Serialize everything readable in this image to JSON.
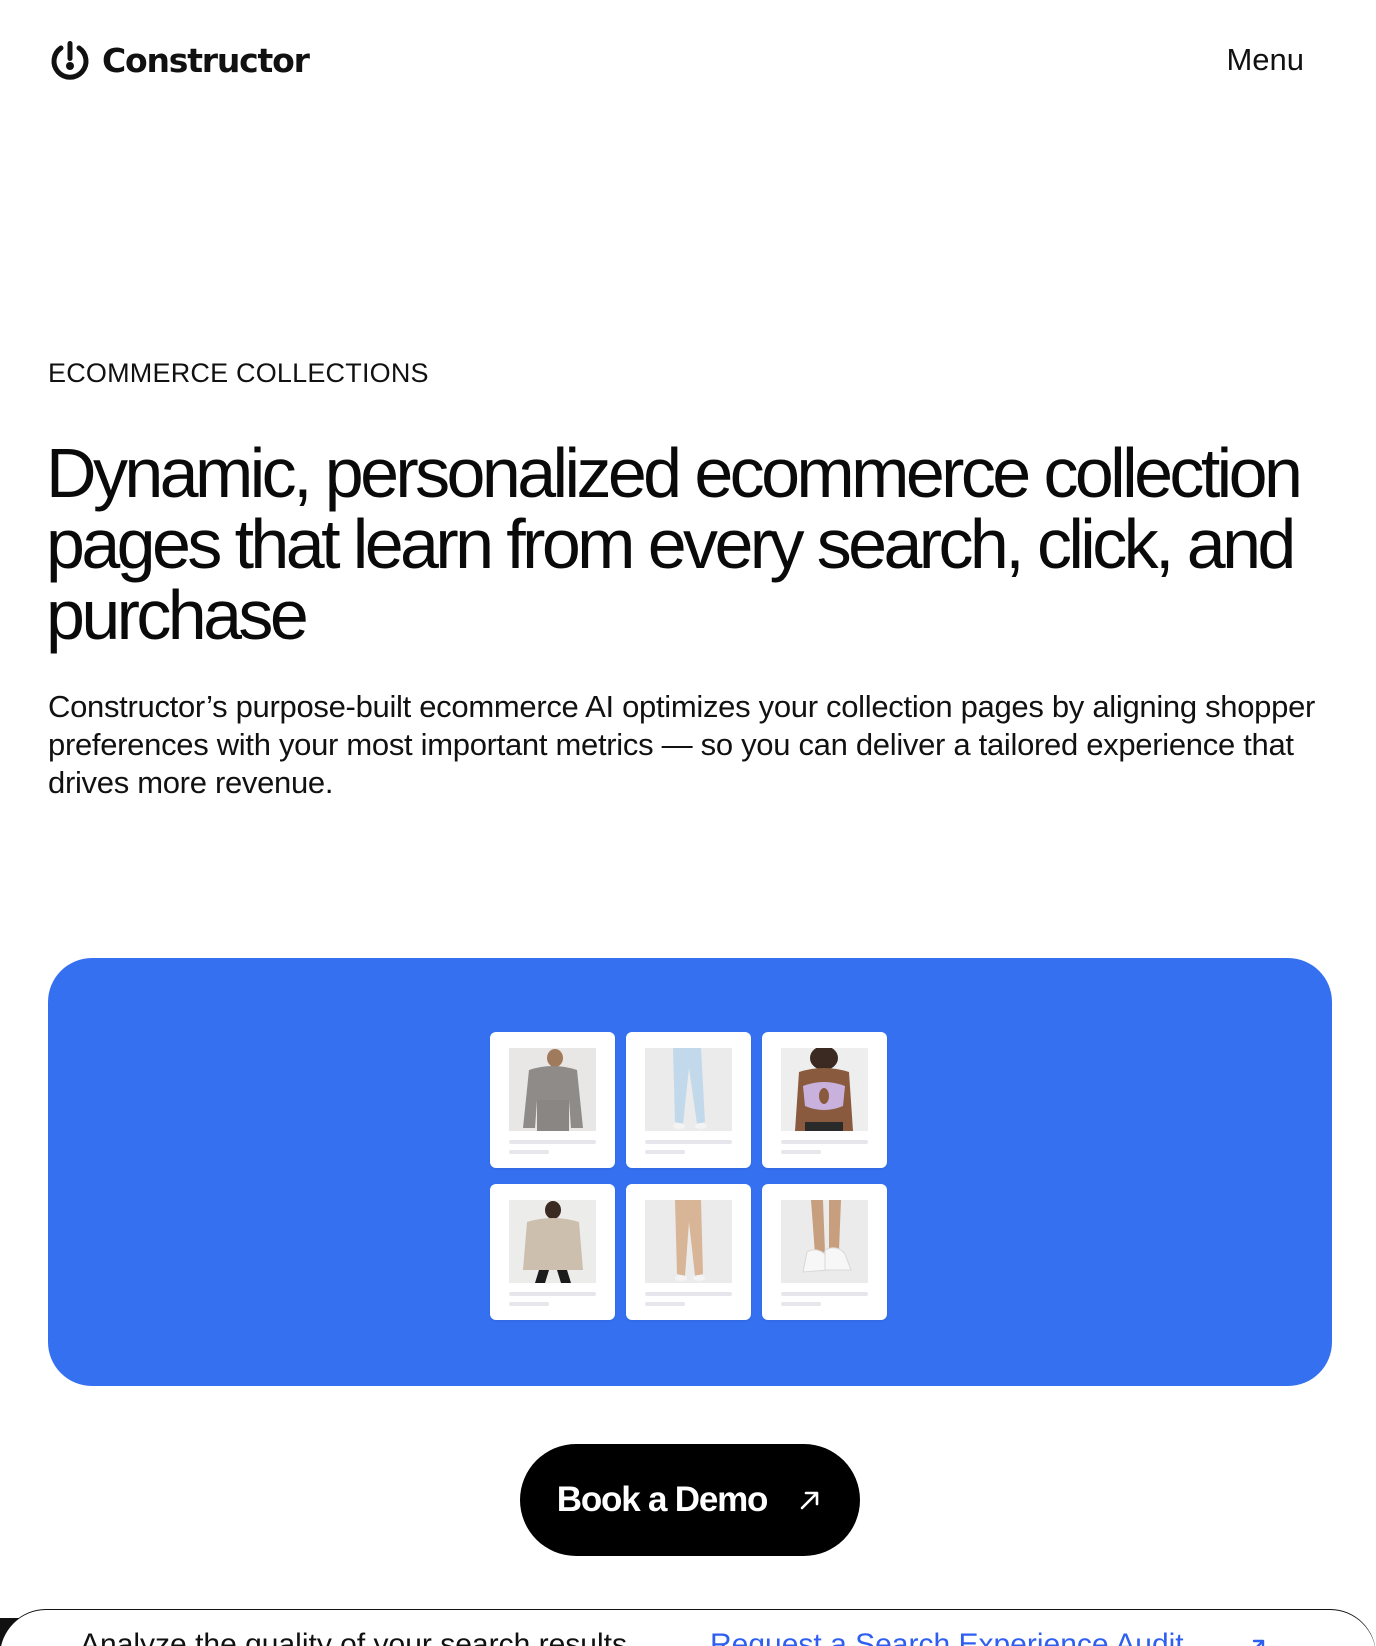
{
  "header": {
    "brand": "Constructor",
    "menu_label": "Menu"
  },
  "hero": {
    "eyebrow": "ECOMMERCE COLLECTIONS",
    "title": "Dynamic, personalized ecommerce collection pages that learn from every search, click, and purchase",
    "description": "Constructor’s purpose-built ecommerce AI optimizes your collection pages by aligning shopper preferences with your most important metrics — so you can deliver a tailored experience that drives more revenue."
  },
  "showcase": {
    "background_color": "#3570f0",
    "products": [
      {
        "icon": "sweatshirt-grey-image"
      },
      {
        "icon": "leggings-light-blue-image"
      },
      {
        "icon": "sports-bra-lavender-image"
      },
      {
        "icon": "sweater-beige-image"
      },
      {
        "icon": "leggings-tan-image"
      },
      {
        "icon": "sneakers-white-image"
      }
    ]
  },
  "cta": {
    "label": "Book a Demo",
    "icon": "arrow-up-right-icon"
  },
  "bottom_bar": {
    "text": "Analyze the quality of your search results",
    "link_label": "Request a Search Experience Audit",
    "link_color": "#2f5ff0",
    "icon": "arrow-up-right-icon"
  }
}
